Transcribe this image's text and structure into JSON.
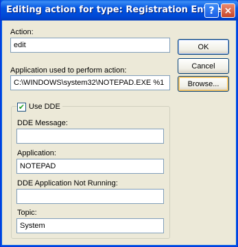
{
  "dialog": {
    "title": "Editing action for type: Registration Entries",
    "help_glyph": "?",
    "close_glyph": "×"
  },
  "action": {
    "label": "Action:",
    "value": "edit"
  },
  "application_cmd": {
    "label": "Application used to perform action:",
    "value": "C:\\WINDOWS\\system32\\NOTEPAD.EXE %1"
  },
  "buttons": {
    "ok": "OK",
    "cancel": "Cancel",
    "browse": "Browse..."
  },
  "dde": {
    "checkbox_label": "Use DDE",
    "checked": true,
    "check_glyph": "✔",
    "message": {
      "label": "DDE Message:",
      "value": ""
    },
    "application": {
      "label": "Application:",
      "value": "NOTEPAD"
    },
    "not_running": {
      "label": "DDE Application Not Running:",
      "value": ""
    },
    "topic": {
      "label": "Topic:",
      "value": "System"
    }
  }
}
